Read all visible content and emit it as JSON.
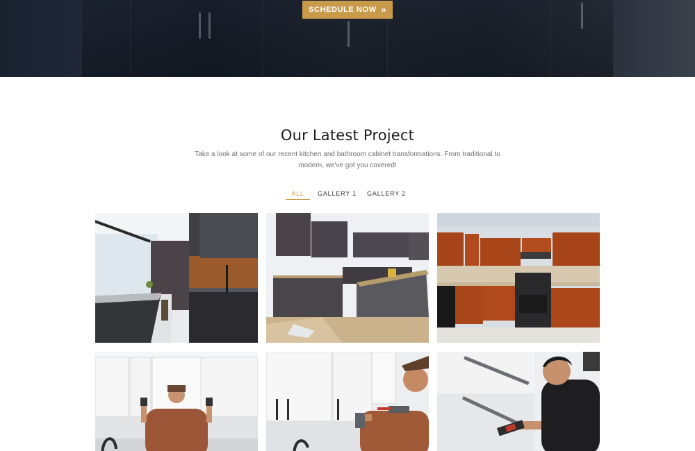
{
  "hero": {
    "cta_label": "SCHEDULE NOW",
    "cta_icon": "double-chevron-right-icon",
    "background": "dark-kitchen-photo"
  },
  "section": {
    "title": "Our Latest Project",
    "subtitle": "Take a look at some of our recent kitchen and bathroom cabinet transformations. From traditional to modern, we've got you covered!"
  },
  "filters": {
    "items": [
      {
        "label": "ALL",
        "active": true
      },
      {
        "label": "GALLERY 1",
        "active": false
      },
      {
        "label": "GALLERY 2",
        "active": false
      }
    ]
  },
  "gallery": {
    "items": [
      {
        "subject": "modern-dark-kitchen-with-wood-backsplash"
      },
      {
        "subject": "kitchen-cabinet-installation-in-progress"
      },
      {
        "subject": "cherry-wood-kitchen-cabinets-with-range"
      },
      {
        "subject": "worker-installing-white-wall-cabinets"
      },
      {
        "subject": "worker-drilling-white-cabinet-door"
      },
      {
        "subject": "technician-fitting-drawer-slides"
      }
    ]
  },
  "colors": {
    "accent": "#c99a4a",
    "hero_bg": "#1e2533",
    "text_dark": "#1c1c1c",
    "text_muted": "#6e6e6e"
  }
}
